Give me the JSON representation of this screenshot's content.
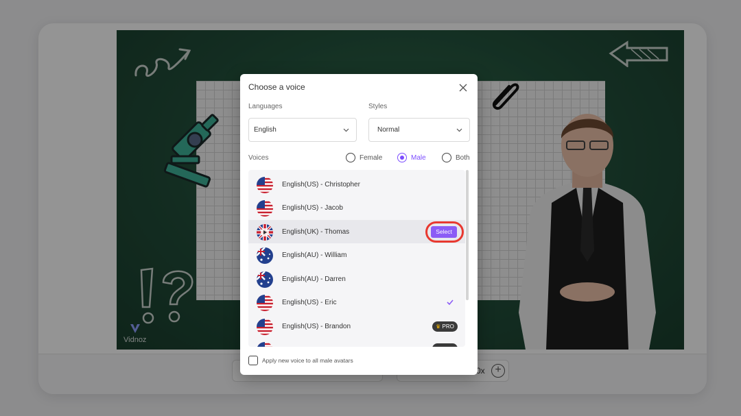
{
  "watermark": {
    "brand": "Vidnoz"
  },
  "bottom_bar": {
    "speed": "0x"
  },
  "modal": {
    "title": "Choose a voice",
    "languages_label": "Languages",
    "styles_label": "Styles",
    "language_value": "English",
    "style_value": "Normal",
    "voices_label": "Voices",
    "gender_options": [
      {
        "label": "Female",
        "selected": false
      },
      {
        "label": "Male",
        "selected": true
      },
      {
        "label": "Both",
        "selected": false
      }
    ],
    "voices": [
      {
        "label": "English(US) - Christopher",
        "flag": "us-flag-icon"
      },
      {
        "label": "English(US) - Jacob",
        "flag": "us-flag-icon"
      },
      {
        "label": "English(UK) - Thomas",
        "flag": "uk-flag-icon",
        "action": "Select"
      },
      {
        "label": "English(AU) - William",
        "flag": "au-flag-icon"
      },
      {
        "label": "English(AU) - Darren",
        "flag": "au-flag-icon"
      },
      {
        "label": "English(US) - Eric",
        "flag": "us-flag-icon",
        "checked": true
      },
      {
        "label": "English(US) - Brandon",
        "flag": "us-flag-icon",
        "badge": "PRO"
      }
    ],
    "apply_all_label": "Apply new voice to all male avatars"
  },
  "colors": {
    "accent": "#8b5cf6",
    "highlight": "#e8382f",
    "board": "#214d39"
  }
}
